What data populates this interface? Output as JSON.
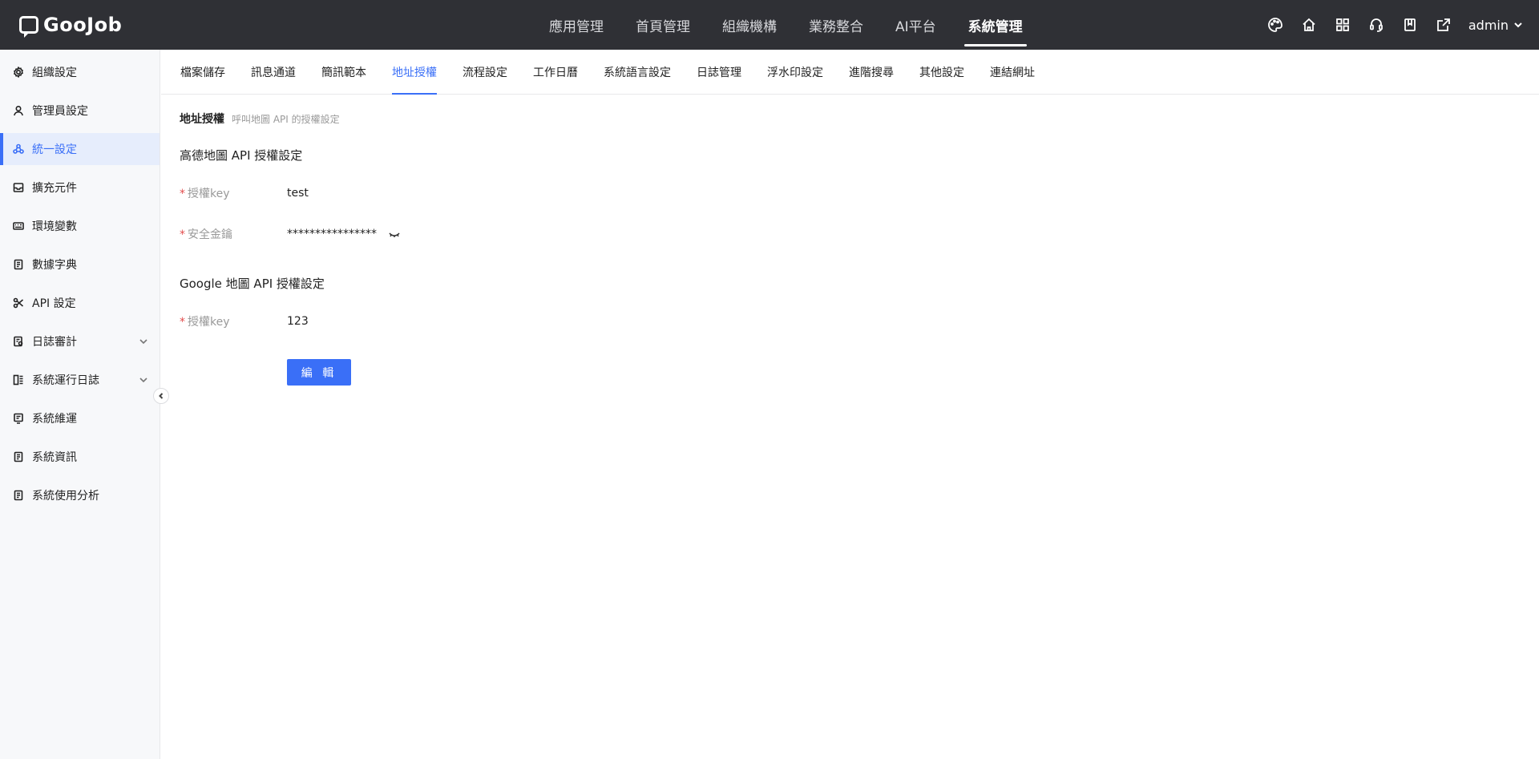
{
  "brand": {
    "name": "GooJob"
  },
  "topnav": {
    "items": [
      {
        "label": "應用管理"
      },
      {
        "label": "首頁管理"
      },
      {
        "label": "組織機構"
      },
      {
        "label": "業務整合"
      },
      {
        "label": "AI平台"
      },
      {
        "label": "系統管理",
        "active": true
      }
    ]
  },
  "top_tools": {
    "icons": [
      "palette-icon",
      "home-icon",
      "apps-grid-icon",
      "headset-icon",
      "book-icon",
      "export-icon"
    ],
    "user": "admin"
  },
  "sidebar": {
    "items": [
      {
        "label": "組織設定",
        "icon": "gear-icon"
      },
      {
        "label": "管理員設定",
        "icon": "user-icon"
      },
      {
        "label": "統一設定",
        "icon": "cluster-icon",
        "active": true
      },
      {
        "label": "擴充元件",
        "icon": "inbox-icon"
      },
      {
        "label": "環境變數",
        "icon": "keyboard-icon"
      },
      {
        "label": "數據字典",
        "icon": "document-icon"
      },
      {
        "label": "API 設定",
        "icon": "scissors-icon"
      },
      {
        "label": "日誌審計",
        "icon": "audit-icon",
        "expandable": true
      },
      {
        "label": "系統運行日誌",
        "icon": "log-icon",
        "expandable": true
      },
      {
        "label": "系統維運",
        "icon": "maintenance-icon"
      },
      {
        "label": "系統資訊",
        "icon": "document-icon"
      },
      {
        "label": "系統使用分析",
        "icon": "document-icon"
      }
    ]
  },
  "subtabs": {
    "items": [
      {
        "label": "檔案儲存"
      },
      {
        "label": "訊息通道"
      },
      {
        "label": "簡訊範本"
      },
      {
        "label": "地址授權",
        "active": true
      },
      {
        "label": "流程設定"
      },
      {
        "label": "工作日曆"
      },
      {
        "label": "系統語言設定"
      },
      {
        "label": "日誌管理"
      },
      {
        "label": "浮水印設定"
      },
      {
        "label": "進階搜尋"
      },
      {
        "label": "其他設定"
      },
      {
        "label": "連結網址"
      }
    ]
  },
  "content": {
    "title": "地址授權",
    "description": "呼叫地圖 API 的授權設定",
    "amap": {
      "group_title": "高德地圖 API 授權設定",
      "key_label": "授權key",
      "key_value": "test",
      "secret_label": "安全金鑰",
      "secret_value": "****************"
    },
    "google": {
      "group_title": "Google 地圖 API 授權設定",
      "key_label": "授權key",
      "key_value": "123"
    },
    "required_mark": "*",
    "edit_label": "編 輯"
  },
  "colors": {
    "topbar_bg": "#2f3035",
    "accent": "#3a6ff7",
    "required": "#e34d4d",
    "sidebar_bg": "#f7f8fa"
  }
}
